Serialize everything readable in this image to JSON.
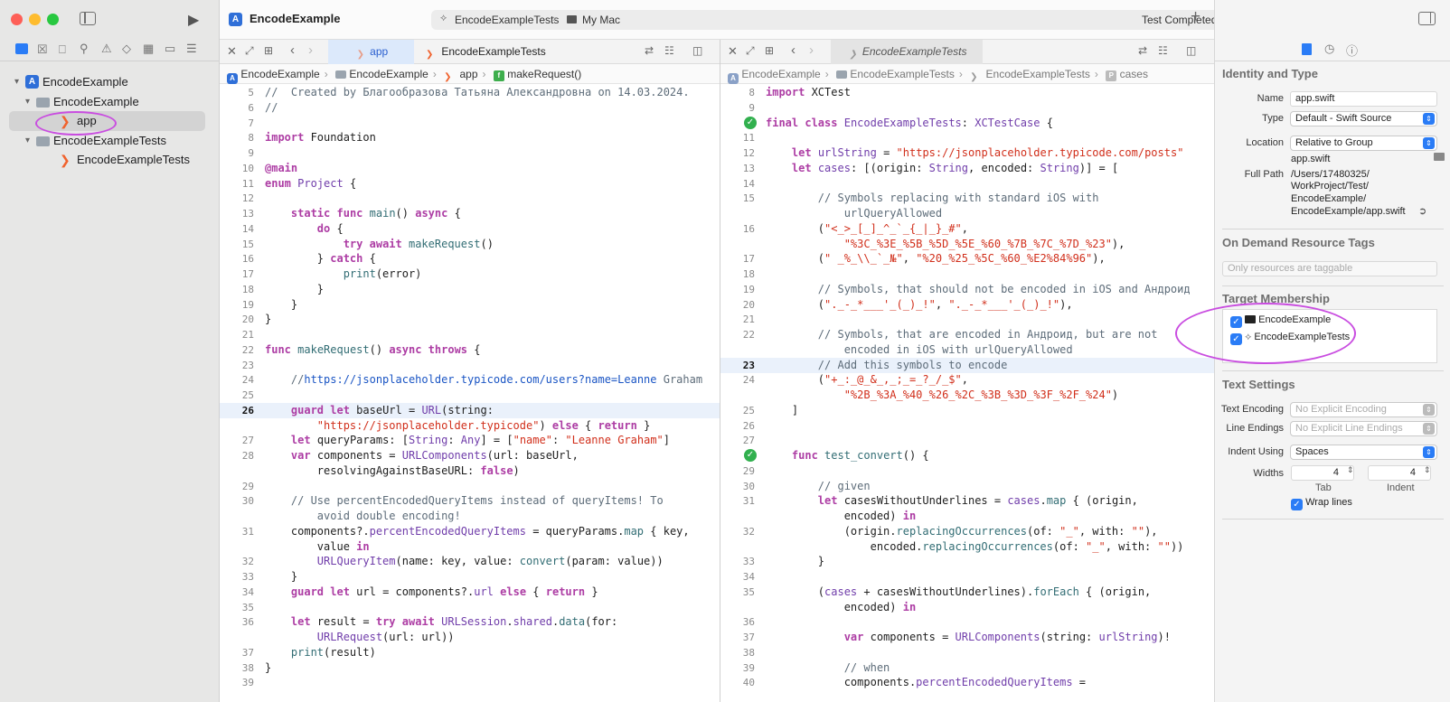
{
  "window": {
    "title": "EncodeExample",
    "scheme": "EncodeExampleTests",
    "destination": "My Mac",
    "status": "Test Completed"
  },
  "navigator": {
    "items": [
      {
        "label": "EncodeExample",
        "kind": "project",
        "level": 0,
        "disclosure": "▾"
      },
      {
        "label": "EncodeExample",
        "kind": "folder",
        "level": 1,
        "disclosure": "▾"
      },
      {
        "label": "app",
        "kind": "swift",
        "level": 2,
        "disclosure": "",
        "selected": true
      },
      {
        "label": "EncodeExampleTests",
        "kind": "folder",
        "level": 1,
        "disclosure": "▾"
      },
      {
        "label": "EncodeExampleTests",
        "kind": "swift",
        "level": 2,
        "disclosure": ""
      }
    ]
  },
  "left_editor": {
    "tabs": [
      "app",
      "EncodeExampleTests"
    ],
    "jumpbar": [
      "EncodeExample",
      "EncodeExample",
      "app",
      "makeRequest()"
    ],
    "current_line": "26",
    "lines": [
      [
        "5",
        "<span class=\"cm\">//  Created by Благообразова Татьяна Александровна on 14.03.2024.</span>"
      ],
      [
        "6",
        "<span class=\"cm\">//</span>"
      ],
      [
        "7",
        ""
      ],
      [
        "8",
        "<span class=\"kw\">import</span> Foundation"
      ],
      [
        "9",
        ""
      ],
      [
        "10",
        "<span class=\"kw\">@main</span>"
      ],
      [
        "11",
        "<span class=\"kw\">enum</span> <span class=\"ty\">Project</span> {"
      ],
      [
        "12",
        ""
      ],
      [
        "13",
        "    <span class=\"kw\">static</span> <span class=\"kw\">func</span> <span class=\"fn\">main</span>() <span class=\"kw\">async</span> {"
      ],
      [
        "14",
        "        <span class=\"kw\">do</span> {"
      ],
      [
        "15",
        "            <span class=\"kw\">try</span> <span class=\"kw\">await</span> <span class=\"fn\">makeRequest</span>()"
      ],
      [
        "16",
        "        } <span class=\"kw\">catch</span> {"
      ],
      [
        "17",
        "            <span class=\"fn\">print</span>(error)"
      ],
      [
        "18",
        "        }"
      ],
      [
        "19",
        "    }"
      ],
      [
        "20",
        "}"
      ],
      [
        "21",
        ""
      ],
      [
        "22",
        "<span class=\"kw\">func</span> <span class=\"fn\">makeRequest</span>() <span class=\"kw\">async</span> <span class=\"kw\">throws</span> {"
      ],
      [
        "23",
        ""
      ],
      [
        "24",
        "    <span class=\"cm\">//<span style=\"color:#1a55c4\">https://jsonplaceholder.typicode.com/users?name=Leanne</span> Graham</span>"
      ],
      [
        "25",
        ""
      ],
      [
        "26",
        "    <span class=\"kw\">guard</span> <span class=\"kw\">let</span> baseUrl = <span class=\"ty\">URL</span>(string:"
      ],
      [
        "",
        "        <span class=\"str\">\"https://jsonplaceholder.typicode\"</span>) <span class=\"kw\">else</span> { <span class=\"kw\">return</span> }"
      ],
      [
        "27",
        "    <span class=\"kw\">let</span> queryParams: [<span class=\"ty\">String</span>: <span class=\"ty\">Any</span>] = [<span class=\"str\">\"name\"</span>: <span class=\"str\">\"Leanne Graham\"</span>]"
      ],
      [
        "28",
        "    <span class=\"kw\">var</span> components = <span class=\"ty\">URLComponents</span>(url: baseUrl,"
      ],
      [
        "",
        "        resolvingAgainstBaseURL: <span class=\"kw\">false</span>)"
      ],
      [
        "29",
        ""
      ],
      [
        "30",
        "    <span class=\"cm\">// Use percentEncodedQueryItems instead of queryItems! To</span>"
      ],
      [
        "",
        "        <span class=\"cm\">avoid double encoding!</span>"
      ],
      [
        "31",
        "    components?.<span class=\"ty\">percentEncodedQueryItems</span> = queryParams.<span class=\"fn\">map</span> { key,"
      ],
      [
        "",
        "        value <span class=\"kw\">in</span>"
      ],
      [
        "32",
        "        <span class=\"ty\">URLQueryItem</span>(name: key, value: <span class=\"fn\">convert</span>(param: value))"
      ],
      [
        "33",
        "    }"
      ],
      [
        "34",
        "    <span class=\"kw\">guard</span> <span class=\"kw\">let</span> url = components?.<span class=\"ty\">url</span> <span class=\"kw\">else</span> { <span class=\"kw\">return</span> }"
      ],
      [
        "35",
        ""
      ],
      [
        "36",
        "    <span class=\"kw\">let</span> result = <span class=\"kw\">try</span> <span class=\"kw\">await</span> <span class=\"ty\">URLSession</span>.<span class=\"ty\">shared</span>.<span class=\"fn\">data</span>(for:"
      ],
      [
        "",
        "        <span class=\"ty\">URLRequest</span>(url: url))"
      ],
      [
        "37",
        "    <span class=\"fn\">print</span>(result)"
      ],
      [
        "38",
        "}"
      ],
      [
        "39",
        ""
      ]
    ]
  },
  "right_editor": {
    "tab": "EncodeExampleTests",
    "jumpbar": [
      "EncodeExample",
      "EncodeExampleTests",
      "EncodeExampleTests",
      "cases"
    ],
    "current_line": "23",
    "lines": [
      [
        "8",
        "<span class=\"kw\">import</span> XCTest"
      ],
      [
        "9",
        ""
      ],
      [
        "10",
        "<span class=\"kw\">final</span> <span class=\"kw\">class</span> <span class=\"ty\">EncodeExampleTests</span>: <span class=\"ty\">XCTestCase</span> {"
      ],
      [
        "11",
        ""
      ],
      [
        "12",
        "    <span class=\"kw\">let</span> <span class=\"ty\">urlString</span> = <span class=\"str\">\"https://jsonplaceholder.typicode.com/posts\"</span>"
      ],
      [
        "13",
        "    <span class=\"kw\">let</span> <span class=\"ty\">cases</span>: [(origin: <span class=\"ty\">String</span>, encoded: <span class=\"ty\">String</span>)] = ["
      ],
      [
        "14",
        ""
      ],
      [
        "15",
        "        <span class=\"cm\">// Symbols replacing with standard iOS with</span>"
      ],
      [
        "",
        "            <span class=\"cm\">urlQueryAllowed</span>"
      ],
      [
        "16",
        "        (<span class=\"str\">\"&lt;_&gt;_[_]_^_`_{_|_}_#\"</span>,"
      ],
      [
        "",
        "            <span class=\"str\">\"%3C_%3E_%5B_%5D_%5E_%60_%7B_%7C_%7D_%23\"</span>),"
      ],
      [
        "17",
        "        (<span class=\"str\">\" _%_\\\\_`_№\"</span>, <span class=\"str\">\"%20_%25_%5C_%60_%E2%84%96\"</span>),"
      ],
      [
        "18",
        ""
      ],
      [
        "19",
        "        <span class=\"cm\">// Symbols, that should not be encoded in iOS and Андроид</span>"
      ],
      [
        "20",
        "        (<span class=\"str\">\"._-_*___'_(_)_!\"</span>, <span class=\"str\">\"._-_*___'_(_)_!\"</span>),"
      ],
      [
        "21",
        ""
      ],
      [
        "22",
        "        <span class=\"cm\">// Symbols, that are encoded in Андроид, but are not</span>"
      ],
      [
        "",
        "            <span class=\"cm\">encoded in iOS with urlQueryAllowed</span>"
      ],
      [
        "23",
        "        <span class=\"cm\">// Add this symbols to encode</span>"
      ],
      [
        "24",
        "        (<span class=\"str\">\"+_:_@_&amp;_,_;_=_?_/_$\"</span>,"
      ],
      [
        "",
        "            <span class=\"str\">\"%2B_%3A_%40_%26_%2C_%3B_%3D_%3F_%2F_%24\"</span>)"
      ],
      [
        "25",
        "    ]"
      ],
      [
        "26",
        ""
      ],
      [
        "27",
        ""
      ],
      [
        "28",
        "    <span class=\"kw\">func</span> <span class=\"fn\">test_convert</span>() {"
      ],
      [
        "29",
        ""
      ],
      [
        "30",
        "        <span class=\"cm\">// given</span>"
      ],
      [
        "31",
        "        <span class=\"kw\">let</span> casesWithoutUnderlines = <span class=\"ty\">cases</span>.<span class=\"fn\">map</span> { (origin,"
      ],
      [
        "",
        "            encoded) <span class=\"kw\">in</span>"
      ],
      [
        "32",
        "            (origin.<span class=\"fn\">replacingOccurrences</span>(of: <span class=\"str\">\"_\"</span>, with: <span class=\"str\">\"\"</span>),"
      ],
      [
        "",
        "                encoded.<span class=\"fn\">replacingOccurrences</span>(of: <span class=\"str\">\"_\"</span>, with: <span class=\"str\">\"\"</span>))"
      ],
      [
        "33",
        "        }"
      ],
      [
        "34",
        ""
      ],
      [
        "35",
        "        (<span class=\"ty\">cases</span> + casesWithoutUnderlines).<span class=\"fn\">forEach</span> { (origin,"
      ],
      [
        "",
        "            encoded) <span class=\"kw\">in</span>"
      ],
      [
        "36",
        ""
      ],
      [
        "37",
        "            <span class=\"kw\">var</span> components = <span class=\"ty\">URLComponents</span>(string: <span class=\"ty\">urlString</span>)!"
      ],
      [
        "38",
        ""
      ],
      [
        "39",
        "            <span class=\"cm\">// when</span>"
      ],
      [
        "40",
        "            components.<span class=\"ty\">percentEncodedQueryItems</span> ="
      ]
    ],
    "test_markers": [
      "10",
      "28"
    ]
  },
  "inspector": {
    "identity": {
      "section": "Identity and Type",
      "name_label": "Name",
      "name_value": "app.swift",
      "type_label": "Type",
      "type_value": "Default - Swift Source",
      "location_label": "Location",
      "location_value": "Relative to Group",
      "location_file": "app.swift",
      "fullpath_label": "Full Path",
      "fullpath_lines": [
        "/Users/17480325/",
        "WorkProject/Test/",
        "EncodeExample/",
        "EncodeExample/app.swift"
      ]
    },
    "ondemand": {
      "section": "On Demand Resource Tags",
      "placeholder": "Only resources are taggable"
    },
    "membership": {
      "section": "Target Membership",
      "targets": [
        "EncodeExample",
        "EncodeExampleTests"
      ]
    },
    "text": {
      "section": "Text Settings",
      "encoding_label": "Text Encoding",
      "encoding_value": "No Explicit Encoding",
      "endings_label": "Line Endings",
      "endings_value": "No Explicit Line Endings",
      "indent_label": "Indent Using",
      "indent_value": "Spaces",
      "widths_label": "Widths",
      "tab_value": "4",
      "indent_width_value": "4",
      "tab_caption": "Tab",
      "indent_caption": "Indent",
      "wrap_label": "Wrap lines"
    }
  },
  "colors": {
    "keyword": "#ad3da4",
    "string": "#d12f1b",
    "comment": "#5d6c79",
    "type": "#703daa",
    "accent": "#2a7cf6",
    "annotation": "#c94de0"
  }
}
